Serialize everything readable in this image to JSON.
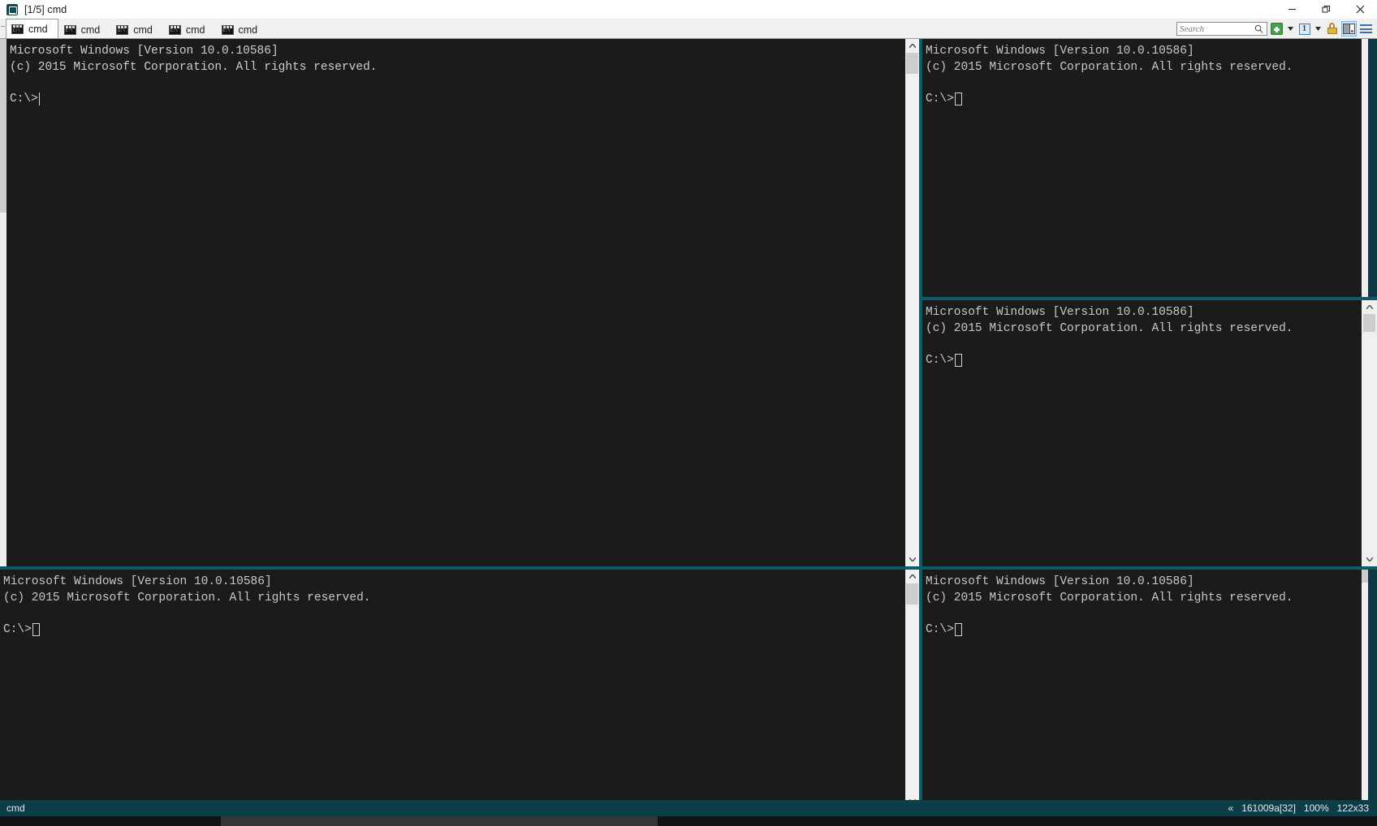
{
  "window": {
    "title": "[1/5] cmd",
    "app_icon": "console-icon",
    "controls": [
      {
        "name": "minimize-button",
        "glyph": "minimize-icon"
      },
      {
        "name": "restore-button",
        "glyph": "restore-icon"
      },
      {
        "name": "close-button",
        "glyph": "close-icon"
      }
    ]
  },
  "tabs": [
    {
      "label": "cmd",
      "active": true
    },
    {
      "label": "cmd",
      "active": false
    },
    {
      "label": "cmd",
      "active": false
    },
    {
      "label": "cmd",
      "active": false
    },
    {
      "label": "cmd",
      "active": false
    }
  ],
  "toolbar": {
    "search": {
      "value": "",
      "placeholder": "Search",
      "icon": "search-icon"
    },
    "buttons": [
      {
        "name": "new-console-button",
        "icon": "green-plus-icon"
      },
      {
        "name": "new-console-dropdown",
        "icon": "chevron-down-icon"
      },
      {
        "name": "active-console-button",
        "icon": "number-one-icon",
        "label": "1"
      },
      {
        "name": "active-console-dropdown",
        "icon": "chevron-down-icon"
      },
      {
        "name": "admin-lock-button",
        "icon": "padlock-icon"
      },
      {
        "name": "split-pane-button",
        "icon": "split-pane-icon"
      },
      {
        "name": "main-menu-button",
        "icon": "hamburger-menu-icon"
      }
    ]
  },
  "terminal": {
    "line1": "Microsoft Windows [Version 10.0.10586]",
    "line2": "(c) 2015 Microsoft Corporation. All rights reserved.",
    "prompt": "C:\\>"
  },
  "panes": [
    {
      "name": "console-pane-top-left",
      "active": true,
      "cursor": "bar"
    },
    {
      "name": "console-pane-top-right",
      "active": false,
      "cursor": "block"
    },
    {
      "name": "console-pane-middle-right",
      "active": false,
      "cursor": "block"
    },
    {
      "name": "console-pane-bottom-left",
      "active": false,
      "cursor": "block"
    },
    {
      "name": "console-pane-bottom-right",
      "active": false,
      "cursor": "block"
    }
  ],
  "statusbar": {
    "left": "cmd",
    "chevrons": "«",
    "build": "161009a[32]",
    "zoom": "100%",
    "size": "122x33"
  },
  "colors": {
    "terminal_bg": "#1b1b1b",
    "terminal_fg": "#c8c8c8",
    "accent_teal": "#0d5a68",
    "status_bg": "#0c3d48",
    "chrome_bg": "#f0f0f0"
  }
}
